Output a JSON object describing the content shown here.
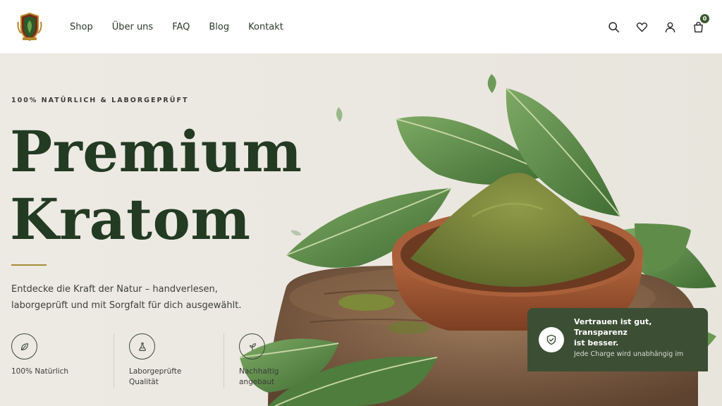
{
  "brand": {
    "logo_icon": "crest-logo-icon"
  },
  "nav": {
    "items": [
      {
        "label": "Shop"
      },
      {
        "label": "Über uns"
      },
      {
        "label": "FAQ"
      },
      {
        "label": "Blog"
      },
      {
        "label": "Kontakt"
      }
    ]
  },
  "header_icons": {
    "search": "search-icon",
    "wishlist": "heart-icon",
    "account": "user-icon",
    "cart": "shopping-bag-icon",
    "cart_count": "0"
  },
  "hero": {
    "eyebrow": "100% NATÜRLICH & LABORGEPRÜFT",
    "title_line1": "Premium",
    "title_line2": "Kratom",
    "subtitle_line1": "Entdecke die Kraft der Natur – handverlesen,",
    "subtitle_line2": "laborgeprüft und mit Sorgfalt für dich ausgewählt.",
    "image": "kratom-powder-bowl-image"
  },
  "features": [
    {
      "icon": "leaf-icon",
      "line1": "100% Natürlich",
      "line2": ""
    },
    {
      "icon": "flask-icon",
      "line1": "Laborgeprüfte",
      "line2": "Qualität"
    },
    {
      "icon": "sprout-icon",
      "line1": "Nachhaltig",
      "line2": "angebaut"
    }
  ],
  "trust": {
    "icon": "shield-check-icon",
    "title_line1": "Vertrauen ist gut, Transparenz",
    "title_line2": "ist besser.",
    "text": "Jede Charge wird unabhängig im"
  },
  "colors": {
    "brand_green": "#233a23",
    "accent_gold": "#a68a3a",
    "card_green": "#3c4e34",
    "background": "#ece9e2"
  }
}
